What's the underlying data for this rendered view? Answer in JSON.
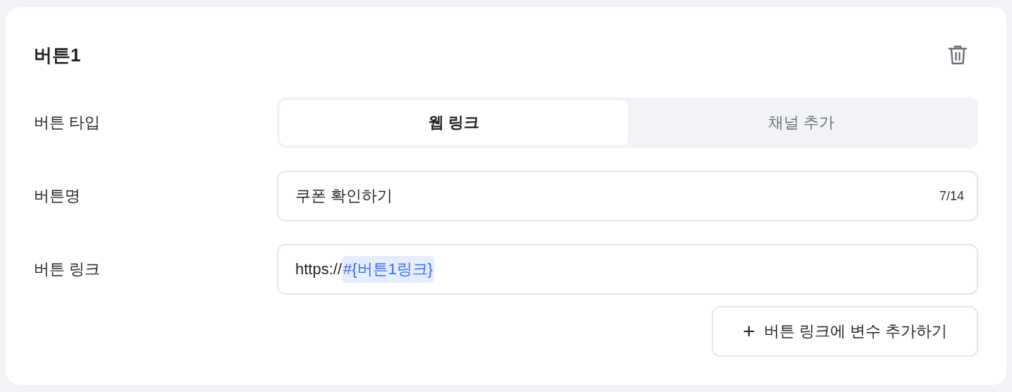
{
  "card": {
    "title": "버튼1"
  },
  "rows": [
    {
      "kind": "segmented",
      "label": "버튼 타입",
      "options": [
        {
          "label": "웹 링크",
          "selected": true
        },
        {
          "label": "채널 추가",
          "selected": false
        }
      ]
    },
    {
      "kind": "input",
      "label": "버튼명",
      "value": "쿠폰 확인하기",
      "counter": "7/14"
    },
    {
      "kind": "link",
      "label": "버튼 링크",
      "segments": [
        {
          "kind": "text",
          "text": "https://"
        },
        {
          "kind": "variable",
          "text": "#{버튼1링크}"
        }
      ]
    }
  ],
  "add_variable_button": {
    "icon": "+",
    "label": "버튼 링크에 변수 추가하기"
  }
}
